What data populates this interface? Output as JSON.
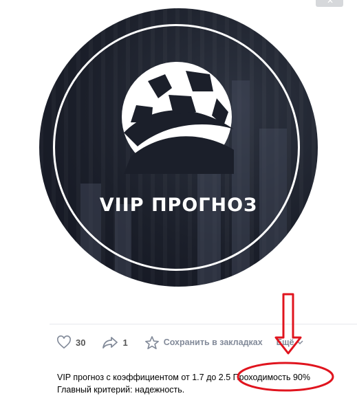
{
  "post": {
    "brand_text": "VIIP ПРОГНОЗ",
    "text_line1": "VIP прогноз с коэффициентом от 1.7 до 2.5 Проходимость 90%",
    "text_line2": "Главный критерий: надежность."
  },
  "actions": {
    "likes_count": "30",
    "shares_count": "1",
    "bookmark_label": "Сохранить в закладках",
    "more_label": "Ещё"
  },
  "icons": {
    "top_corner": "close-icon",
    "like": "heart-icon",
    "share": "share-arrow-icon",
    "bookmark": "star-icon",
    "more": "chevron-down-icon"
  },
  "colors": {
    "annotation": "#e0141e",
    "icon_gray": "#828a99",
    "image_bg": "#1b1f2a"
  }
}
